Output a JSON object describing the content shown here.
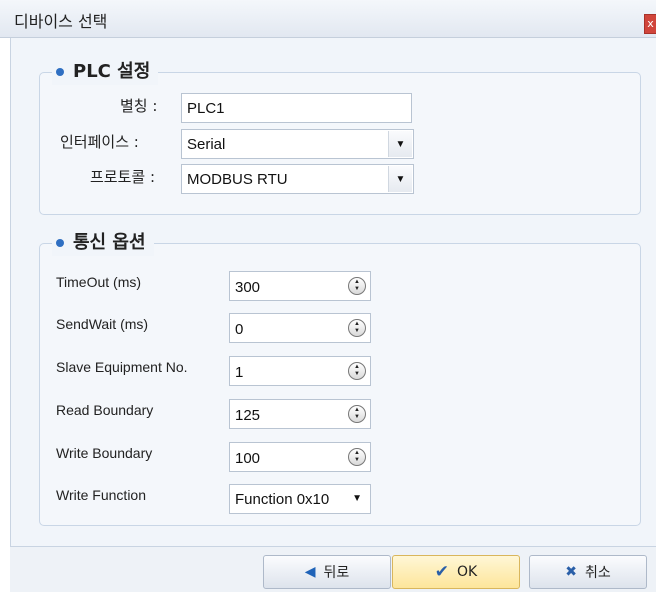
{
  "window": {
    "title": "디바이스 선택",
    "close_glyph": "x"
  },
  "plc_group": {
    "title": "PLC 설정",
    "alias": {
      "label": "별칭 :",
      "value": "PLC1"
    },
    "interface": {
      "label": "인터페이스 :",
      "value": "Serial"
    },
    "protocol": {
      "label": "프로토콜 :",
      "value": "MODBUS RTU"
    }
  },
  "comm_group": {
    "title": "통신 옵션",
    "timeout": {
      "label": "TimeOut (ms)",
      "value": "300"
    },
    "send_wait": {
      "label": "SendWait (ms)",
      "value": "0"
    },
    "slave_no": {
      "label": "Slave Equipment No.",
      "value": "1"
    },
    "read_boundary": {
      "label": "Read Boundary",
      "value": "125"
    },
    "write_boundary": {
      "label": "Write Boundary",
      "value": "100"
    },
    "write_function": {
      "label": "Write Function",
      "value": "Function 0x10"
    }
  },
  "footer": {
    "back_label": "뒤로",
    "ok_label": "OK",
    "cancel_label": "취소"
  },
  "icons": {
    "bullet": "bullet-dot-icon",
    "back": "arrow-left-icon",
    "ok": "checkmark-icon",
    "cancel": "x-icon",
    "spinner": "spin-updown-icon",
    "dropdown": "dropdown-arrow-icon"
  },
  "colors": {
    "accent": "#2f6fc2",
    "ok_button": "#fde59a",
    "close_button": "#d0453b"
  }
}
